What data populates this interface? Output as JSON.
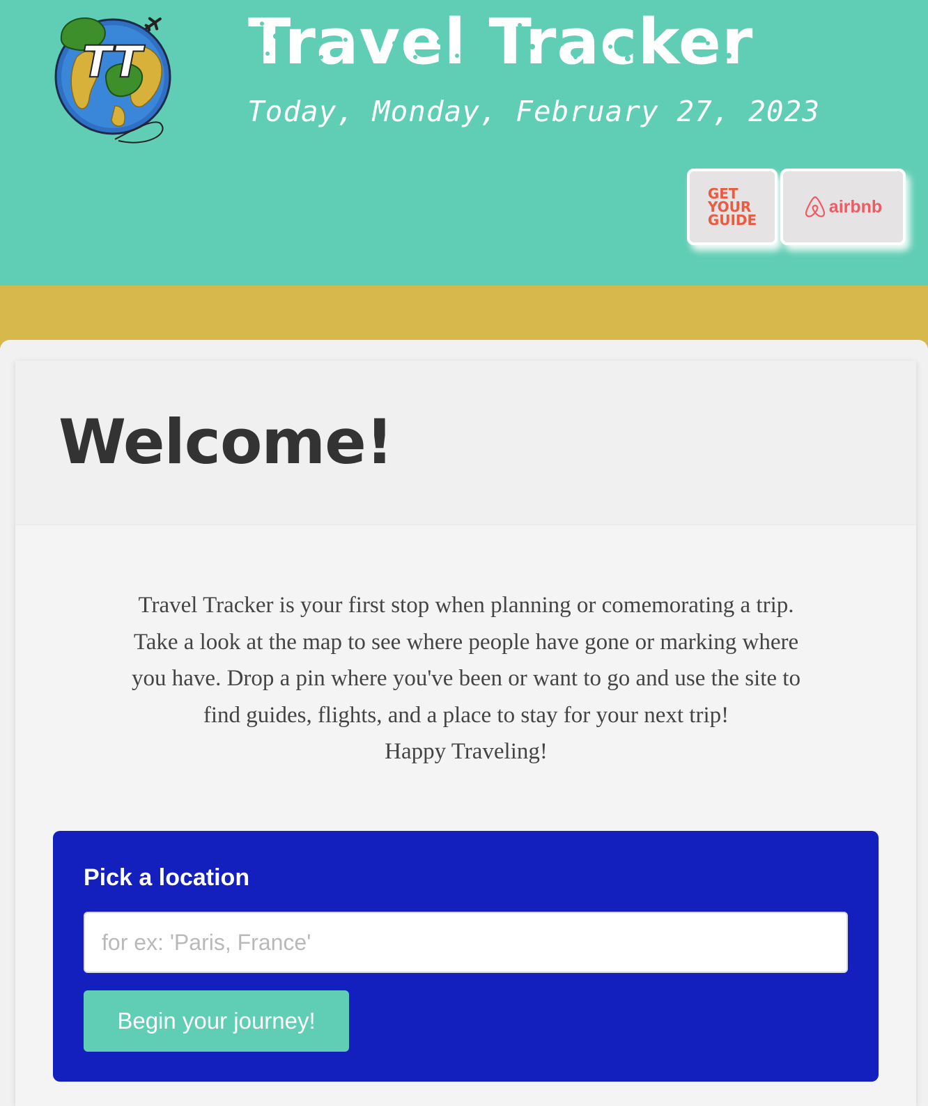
{
  "header": {
    "site_title": "Travel Tracker",
    "logo_text": "TT",
    "today_text": "Today, Monday, February 27, 2023",
    "partners": {
      "getyourguide_lines": [
        "GET",
        "YOUR",
        "GUIDE"
      ],
      "airbnb_label": "airbnb"
    },
    "colors": {
      "header_bg": "#60ceb4",
      "gold_band": "#d6b84d",
      "gyg_orange": "#ea5b3f",
      "airbnb_red": "#ee5b63"
    }
  },
  "welcome": {
    "title": "Welcome!",
    "intro_lines": [
      "Travel Tracker is your first stop when planning or comemorating a trip.",
      "Take a look at the map to see where people have gone or marking where",
      "you have. Drop a pin where you've been or want to go and use the site to",
      "find guides, flights, and a place to stay for your next trip!",
      "Happy Traveling!"
    ]
  },
  "location_form": {
    "label": "Pick a location",
    "input_placeholder": "for ex: 'Paris, France'",
    "input_value": "",
    "submit_label": "Begin your journey!",
    "colors": {
      "panel_bg": "#1420bd",
      "button_bg": "#60ceb4"
    }
  }
}
